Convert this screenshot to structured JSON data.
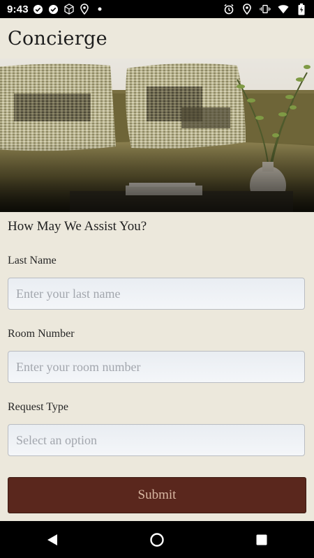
{
  "status_bar": {
    "time": "9:43",
    "left_icons": [
      "check-circle-icon",
      "check-circle-icon",
      "cube-icon",
      "location-pin-icon",
      "dot-icon"
    ],
    "right_icons": [
      "alarm-icon",
      "location-icon",
      "vibrate-icon",
      "wifi-icon",
      "battery-icon"
    ]
  },
  "app_bar": {
    "title": "Concierge"
  },
  "hero": {
    "image": "living-room-pillows-photo"
  },
  "form": {
    "heading": "How May We Assist You?",
    "last_name": {
      "label": "Last Name",
      "placeholder": "Enter your last name",
      "value": ""
    },
    "room_number": {
      "label": "Room Number",
      "placeholder": "Enter your room number",
      "value": ""
    },
    "request_type": {
      "label": "Request Type",
      "selected": "Select an option"
    },
    "submit_label": "Submit"
  },
  "colors": {
    "background": "#ece8dc",
    "submit_bg": "#5a271d",
    "submit_text": "#d9b8a3"
  },
  "nav_bar": {
    "icons": [
      "back-icon",
      "home-icon",
      "recents-icon"
    ]
  }
}
